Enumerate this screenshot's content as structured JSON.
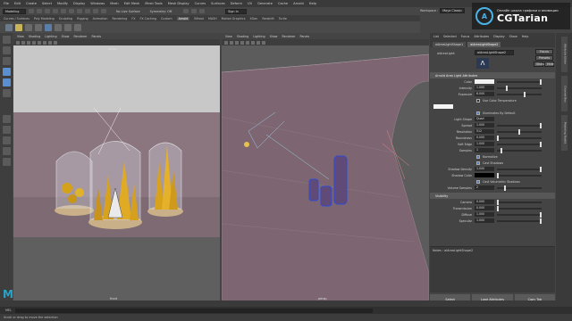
{
  "menubar": [
    "File",
    "Edit",
    "Create",
    "Select",
    "Modify",
    "Display",
    "Windows",
    "Mesh",
    "Edit Mesh",
    "Mesh Tools",
    "Mesh Display",
    "Curves",
    "Surfaces",
    "Deform",
    "UV",
    "Generate",
    "Cache",
    "Arnold",
    "Help"
  ],
  "workspace": {
    "label": "Workspace :",
    "value": "Maya Classic"
  },
  "statusline": {
    "mode": "Modeling",
    "no_live": "No Live Surface",
    "symmetry": "Symmetry: Off",
    "signin": "Sign In"
  },
  "shelf_tabs": [
    "Curves / Surfaces",
    "Poly Modeling",
    "Sculpting",
    "Rigging",
    "Animation",
    "Rendering",
    "FX",
    "FX Caching",
    "Custom",
    "Arnold",
    "Bifrost",
    "MASH",
    "Motion Graphics",
    "XGen",
    "Redshift",
    "Turtle"
  ],
  "shelf_active": "Arnold",
  "left_pane": {
    "menu": [
      "View",
      "Shading",
      "Lighting",
      "Show",
      "Renderer",
      "Panels"
    ],
    "camera_label": "persp",
    "bottom_label": "front"
  },
  "right_pane": {
    "menu": [
      "View",
      "Shading",
      "Lighting",
      "Show",
      "Renderer",
      "Panels"
    ],
    "bottom_label": "persp"
  },
  "attribute_editor": {
    "menu": [
      "List",
      "Selected",
      "Focus",
      "Attributes",
      "Display",
      "Show",
      "Help"
    ],
    "tabs": [
      "aiAreaLightShape1",
      "aiAreaLightShape2"
    ],
    "node_label": "aiAreaLight:",
    "node_value": "aiAreaLightShape2",
    "focus_btn": "Focus",
    "presets_btn": "Presets",
    "show_btn": "Show",
    "hide_btn": "Hide",
    "section_title": "Arnold Area Light Attributes",
    "attrs": [
      {
        "label": "Color",
        "value": ""
      },
      {
        "label": "Intensity",
        "value": "1.000"
      },
      {
        "label": "Exposure",
        "value": "6.000"
      }
    ],
    "use_color_temp": "Use Color Temperature",
    "illuminates_default": "Illuminates By Default",
    "light_shape": {
      "label": "Light Shape",
      "value": "Quad"
    },
    "attrs2": [
      {
        "label": "Spread",
        "value": "1.000"
      },
      {
        "label": "Resolution",
        "value": "512"
      },
      {
        "label": "Roundness",
        "value": "0.000"
      },
      {
        "label": "Soft Edge",
        "value": "1.000"
      },
      {
        "label": "Samples",
        "value": "1"
      }
    ],
    "normalize": "Normalize",
    "cast_shadows": "Cast Shadows",
    "shadow_density": {
      "label": "Shadow Density",
      "value": "1.000"
    },
    "shadow_color": {
      "label": "Shadow Color",
      "value": ""
    },
    "cast_vol_shadows": "Cast Volumetric Shadows",
    "volume_samples": {
      "label": "Volume Samples",
      "value": "2"
    },
    "visibility_title": "Visibility",
    "visibility": [
      {
        "label": "Camera",
        "value": "0.000"
      },
      {
        "label": "Transmission",
        "value": "0.000"
      },
      {
        "label": "Diffuse",
        "value": "1.000"
      },
      {
        "label": "Specular",
        "value": "1.000"
      }
    ],
    "notes": "Notes : aiAreaLightShape2",
    "footer": [
      "Select",
      "Load Attributes",
      "Copy Tab"
    ]
  },
  "right_vtabs": [
    "Attribute Editor",
    "Channel Box",
    "Modeling Toolkit"
  ],
  "command_line": {
    "lang": "MEL",
    "text": ""
  },
  "help_line": "Scroll or drag to move the selection",
  "brand": {
    "subtitle": "Онлайн школа графики и анимации",
    "name": "CGTarian",
    "logo": "A-logo"
  },
  "colors": {
    "accent": "#4ab3e6",
    "select": "#5a8fd0",
    "maya": "#29a4c9"
  }
}
